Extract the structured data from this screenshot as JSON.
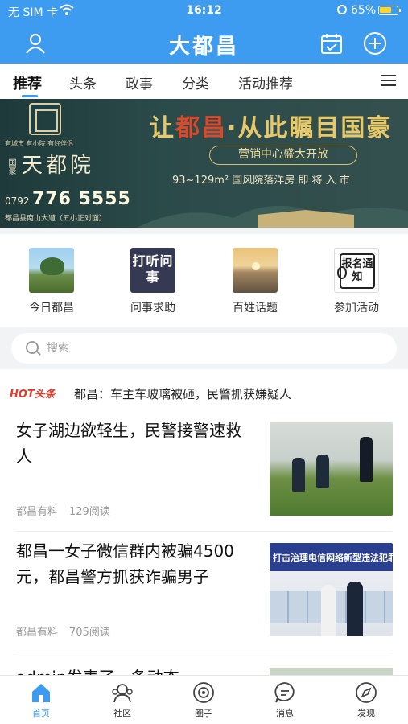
{
  "status_bar": {
    "carrier": "无 SIM 卡",
    "time": "16:12",
    "battery": "65%"
  },
  "header": {
    "title": "大都昌"
  },
  "tabs": [
    {
      "label": "推荐",
      "active": true
    },
    {
      "label": "头条"
    },
    {
      "label": "政事"
    },
    {
      "label": "分类"
    },
    {
      "label": "活动推荐"
    }
  ],
  "banner": {
    "small_slogan": "有城市  有小院  有好伴侣",
    "brand_prefix": "国豪",
    "brand": "天都院",
    "phone_prefix": "0792",
    "phone": "776 5555",
    "address": "都昌县南山大道（五小正对面）",
    "headline_a": "让",
    "headline_b": "都昌",
    "headline_c": "·从此瞩目国豪",
    "pill": "营销中心盛大开放",
    "desc": "93~129m² 国风院落洋房  即 将 入 市"
  },
  "quick_entries": [
    {
      "label": "今日都昌",
      "icon": "landscape-photo"
    },
    {
      "label": "问事求助",
      "icon_text": "打听问事"
    },
    {
      "label": "百姓话题",
      "icon": "sunset-photo"
    },
    {
      "label": "参加活动",
      "icon_text": "报名通知"
    }
  ],
  "search": {
    "placeholder": "搜索"
  },
  "hot": {
    "badge": "HOT头条",
    "text": "都昌：车主车玻璃被砸，民警抓获嫌疑人"
  },
  "news": [
    {
      "title": "女子湖边欲轻生，民警接警速救人",
      "source": "都昌有料",
      "reads": "129阅读"
    },
    {
      "title": "都昌一女子微信群内被骗4500元，都昌警方抓获诈骗男子",
      "source": "都昌有料",
      "reads": "705阅读",
      "thumb_banner": "打击治理电信网络新型违法犯罪"
    }
  ],
  "partial_news": {
    "title": "admin发表了一条动态"
  },
  "bottom_nav": [
    {
      "label": "首页",
      "active": true,
      "icon": "home-icon"
    },
    {
      "label": "社区",
      "icon": "community-icon"
    },
    {
      "label": "圈子",
      "icon": "circle-icon"
    },
    {
      "label": "消息",
      "icon": "message-icon"
    },
    {
      "label": "发现",
      "icon": "compass-icon"
    }
  ],
  "colors": {
    "primary": "#3d9cf0",
    "hot": "#e43b2c"
  }
}
